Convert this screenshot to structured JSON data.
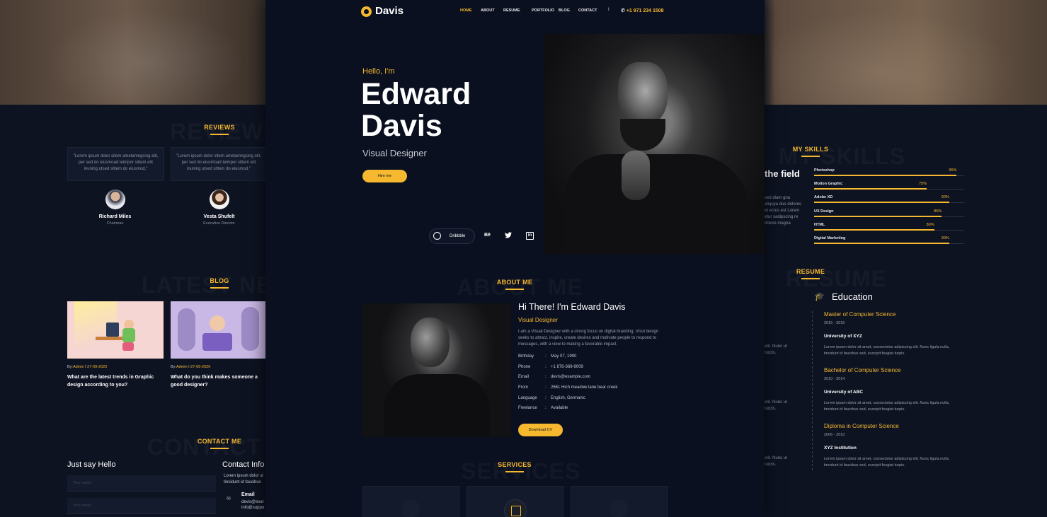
{
  "header": {
    "logo_text": "Davis",
    "nav": [
      "HOME",
      "ABOUT",
      "RESUME",
      "PORTFOLIO",
      "BLOG",
      "CONTACT"
    ],
    "phone": "+1 971 234 1508",
    "menu_separator": "I"
  },
  "hero": {
    "greeting": "Hello, I'm",
    "name_line1": "Edward",
    "name_line2": "Davis",
    "role": "Visual Designer",
    "cta": "Hire me",
    "social_dribbble": "Dribbble",
    "social_behance": "Bē"
  },
  "about": {
    "section_title": "ABOUT ME",
    "ghost": "ABOUT ME",
    "heading": "Hi There! I'm Edward Davis",
    "role": "Visual Designer",
    "description": "I am a Visual Designer with a strong focus on digital branding. Visul design seeks to attract, inspire, create desires and motivate people to respond to messages, with a view to making a favorable impact.",
    "details": [
      {
        "label": "Birthday",
        "value": "May 07, 1990"
      },
      {
        "label": "Phone",
        "value": "+1 876-369-9009"
      },
      {
        "label": "Email",
        "value": "devis@example.com"
      },
      {
        "label": "From",
        "value": "2661 Hich meadow lane bear creek"
      },
      {
        "label": "Language",
        "value": "English, Germanic"
      },
      {
        "label": "Freelance",
        "value": "Available"
      }
    ],
    "separator": ":",
    "download": "Download CV"
  },
  "services": {
    "section_title": "SERVICES",
    "ghost": "SERVICES"
  },
  "reviews": {
    "section_title": "REVIEWS",
    "ghost": "REVIEWS",
    "items": [
      {
        "quote": "\"Lorem ipsum dolor sitem ametamngcing elit, per sed do eiusmoad teimpor sittem elit inuning utsed sittem do eiusmod.\"",
        "name": "Richard Miles",
        "role": "Chairman"
      },
      {
        "quote": "\"Lorem ipsum dolor sitem ametamngcing elit, per sed do eiusmoad teimpor sittem elit inuning utsed sittem do eiusmod.\"",
        "name": "Vesta Shufelt",
        "role": "Executive Director"
      }
    ]
  },
  "blog": {
    "section_title": "BLOG",
    "ghost": "LATEST NEWS",
    "posts": [
      {
        "by": "By:",
        "author": "Admin",
        "sep": "I",
        "date": "27-09-2020",
        "title": "What are the latest trends in Graphic design according to you?"
      },
      {
        "by": "By:",
        "author": "Admin",
        "sep": "I",
        "date": "27-09-2020",
        "title": "What do you think makes someone a good designer?"
      }
    ]
  },
  "contact": {
    "section_title": "CONTACT ME",
    "ghost": "CONTACT",
    "hello": "Just say Hello",
    "info_title": "Contact Info",
    "name_placeholder": "Your name",
    "email_placeholder": "Your email",
    "info_text": "Lorem ipsum dolor si tincidunt id faucibus",
    "email_label": "Email",
    "email_1": "devis@exar",
    "email_2": "info@suppo"
  },
  "skills": {
    "section_title": "MY SKILLS",
    "ghost": "MY SKILLS",
    "side_heading": "the field",
    "side_text": "sed diam gna aliquya duo dolores et ectus est Lorem etur sadipscing re dolore magna",
    "items": [
      {
        "name": "Photoshop",
        "percent": 95,
        "label": "95%"
      },
      {
        "name": "Motion Graphic",
        "percent": 75,
        "label": "75%"
      },
      {
        "name": "Adobe XD",
        "percent": 90,
        "label": "90%"
      },
      {
        "name": "UX Design",
        "percent": 85,
        "label": "85%"
      },
      {
        "name": "HTML",
        "percent": 80,
        "label": "80%"
      },
      {
        "name": "Digital Marketing",
        "percent": 90,
        "label": "90%"
      }
    ]
  },
  "resume": {
    "section_title": "RESUME",
    "ghost": "RESUME",
    "education_title": "Education",
    "side_snippet": "elit. Nunc ur turpis.",
    "items": [
      {
        "degree": "Master of Computer Science",
        "years": "2015 - 2016",
        "school": "University of XYZ",
        "desc": "Lorem ipsum dolor sit amet, consectetur adipiscing elit. Nunc ligula nulla, tincidunt id faucibus sed, suscipit feugiat turpis."
      },
      {
        "degree": "Bachelor of Computer Science",
        "years": "2010 - 2014",
        "school": "University of ABC",
        "desc": "Lorem ipsum dolor sit amet, consectetur adipiscing elit. Nunc ligula nulla, tincidunt id faucibus sed, suscipit feugiat turpis."
      },
      {
        "degree": "Diploma in Computer Science",
        "years": "2006 - 2010",
        "school": "XYZ Institution",
        "desc": "Lorem ipsum dolor sit amet, consectetur adipiscing elit. Nunc ligula nulla, tincidunt id faucibus sed, suscipit feugiat turpis."
      }
    ]
  },
  "colors": {
    "accent": "#f5b82e",
    "background": "#0b1020"
  }
}
